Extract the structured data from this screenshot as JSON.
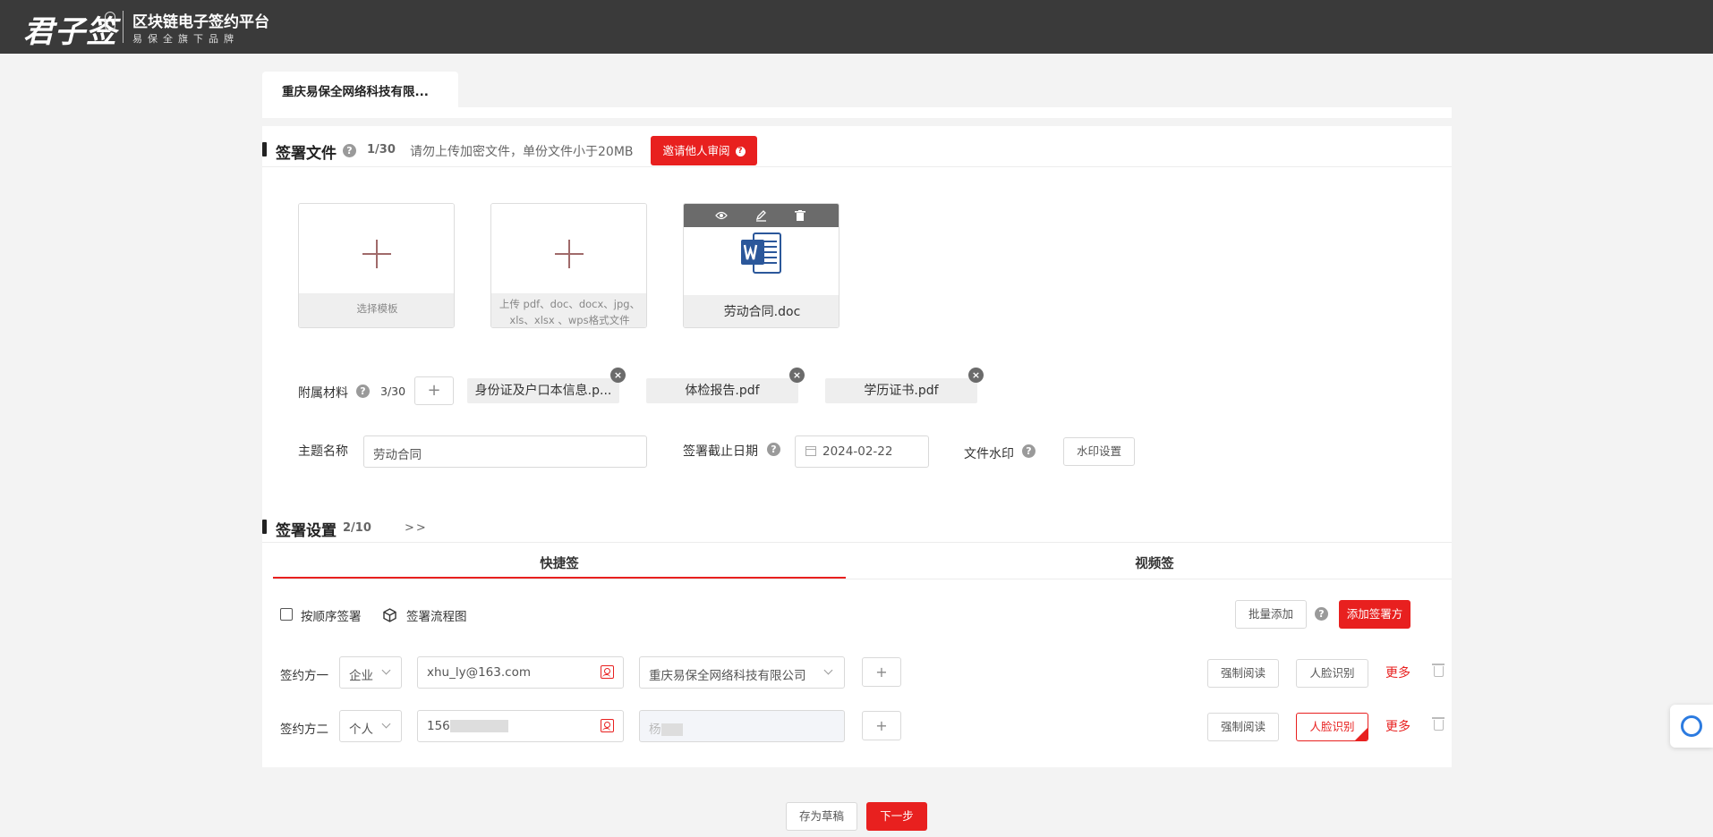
{
  "header": {
    "logo_text": "君子签",
    "platform_name": "区块链电子签约平台",
    "platform_sub": "易保全旗下品牌"
  },
  "company_tab": "重庆易保全网络科技有限...",
  "sign_files": {
    "title": "签署文件",
    "count": "1/30",
    "hint": "请勿上传加密文件，单份文件小于20MB",
    "invite_button": "邀请他人审阅",
    "template_card_label": "选择模板",
    "upload_card_label_1": "上传 pdf、doc、docx、jpg、",
    "upload_card_label_2": "xls、xlsx 、wps格式文件",
    "file_name": "劳动合同.doc"
  },
  "attachments": {
    "label": "附属材料",
    "count": "3/30",
    "items": [
      "身份证及户口本信息.p...",
      "体检报告.pdf",
      "学历证书.pdf"
    ]
  },
  "form": {
    "subject_label": "主题名称",
    "subject_value": "劳动合同",
    "deadline_label": "签署截止日期",
    "deadline_value": "2024-02-22",
    "watermark_label": "文件水印",
    "watermark_button": "水印设置"
  },
  "sign_settings": {
    "title": "签署设置",
    "count": "2/10",
    "expand": ">>",
    "tabs": [
      "快捷签",
      "视频签"
    ],
    "sequential_label": "按顺序签署",
    "flowchart_label": "签署流程图",
    "batch_add": "批量添加",
    "add_signer": "添加签署方",
    "signers": [
      {
        "label": "签约方一",
        "type": "企业",
        "contact": "xhu_ly@163.com",
        "org": "重庆易保全网络科技有限公司",
        "force_read": "强制阅读",
        "face_id": "人脸识别",
        "more": "更多"
      },
      {
        "label": "签约方二",
        "type": "个人",
        "contact": "156",
        "org": "杨",
        "force_read": "强制阅读",
        "face_id": "人脸识别",
        "more": "更多"
      }
    ]
  },
  "footer": {
    "save_draft": "存为草稿",
    "next": "下一步"
  },
  "colors": {
    "accent": "#e8201f",
    "header_bg": "#3a3a3a",
    "word_blue": "#2b579a"
  }
}
